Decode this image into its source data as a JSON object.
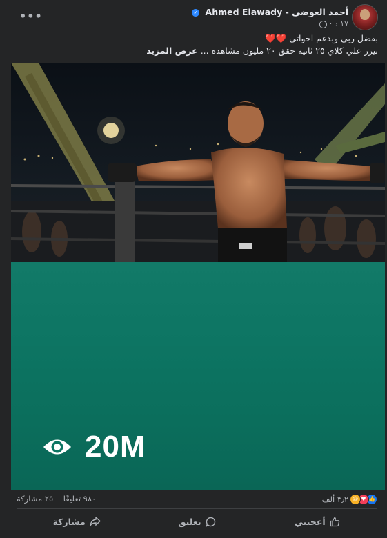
{
  "post": {
    "author": "أحمد العوضي - Ahmed Elawady",
    "time": "١٧ د ·",
    "caption_line1": "بفضل ربي وبدعم اخواتي",
    "caption_hearts": "❤️❤️",
    "caption_line2": "تيزر علي كلاي ٢٥ ثانيه حقق ٢٠ مليون مشاهده ...",
    "see_more": "عرض المزيد",
    "more_menu": "•••"
  },
  "media": {
    "views": "20M",
    "icon": "eye-icon"
  },
  "stats": {
    "reactions_count": "٣٫٢ ألف",
    "comments": "٩٨٠ تعليقًا",
    "shares": "٢٥ مشاركة"
  },
  "actions": {
    "like": "أعجبني",
    "comment": "تعليق",
    "share": "مشاركة"
  },
  "colors": {
    "card": "#242526",
    "teal": "#0d7563",
    "verified": "#2d88ff"
  }
}
